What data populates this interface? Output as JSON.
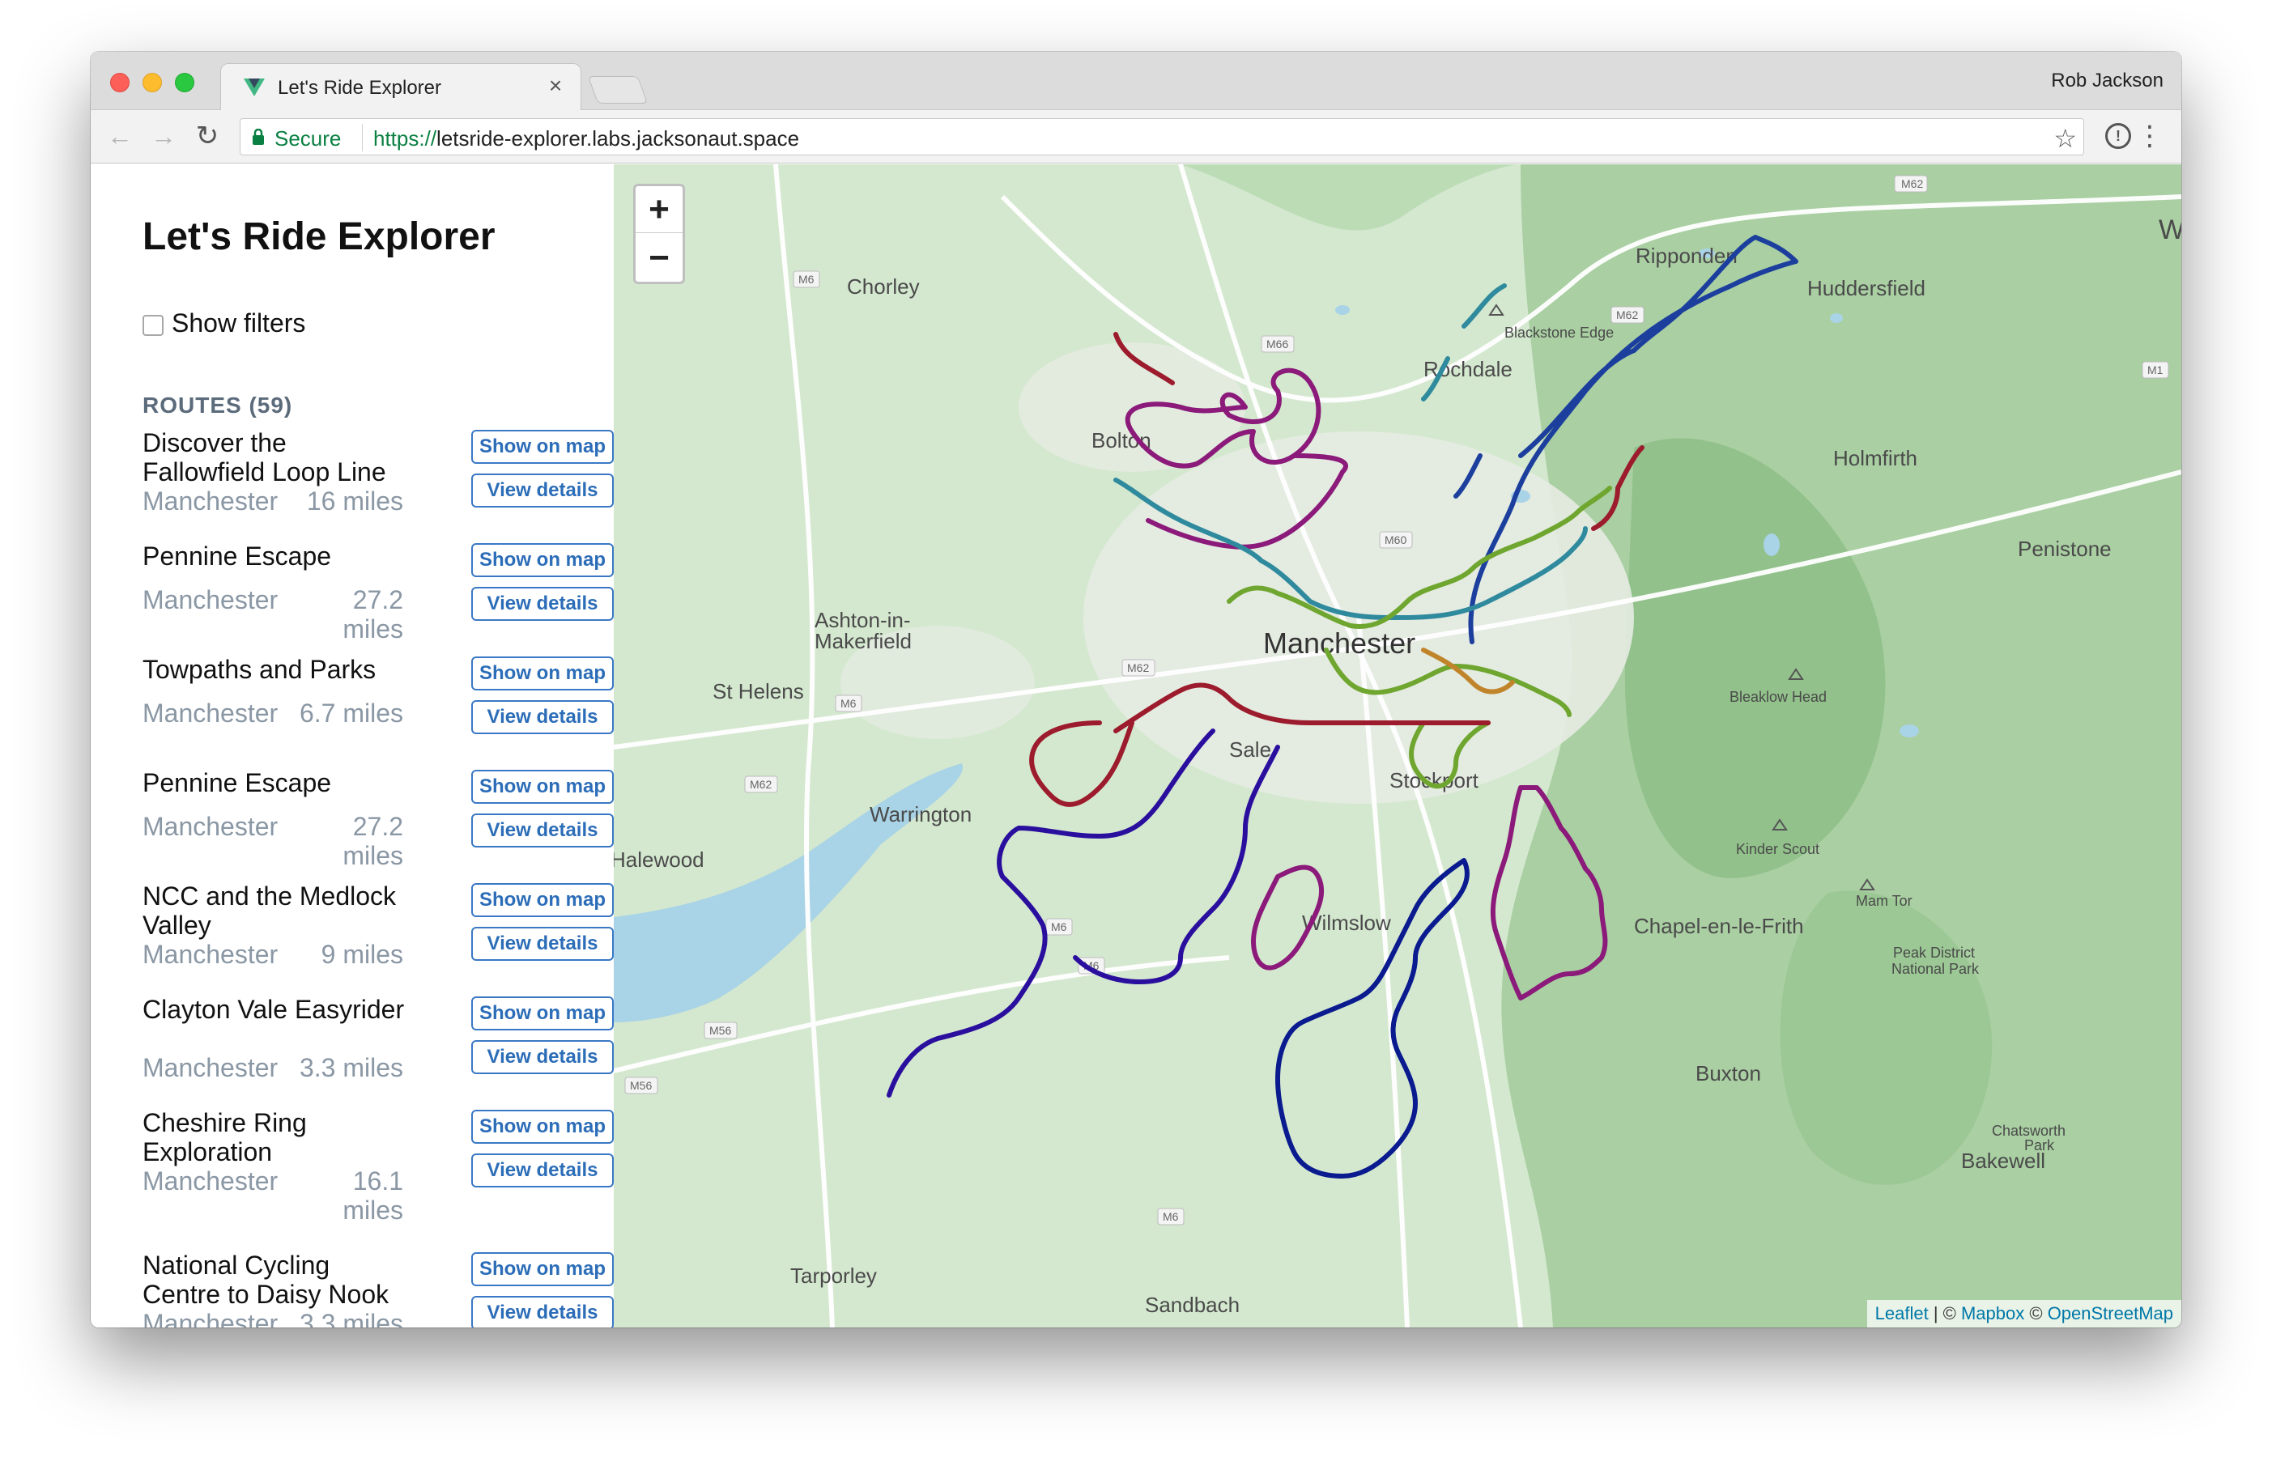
{
  "browser": {
    "tab_title": "Let's Ride Explorer",
    "tab_close": "×",
    "profile_name": "Rob Jackson",
    "secure_label": "Secure",
    "url_scheme": "https://",
    "url_rest": "letsride-explorer.labs.jacksonaut.space"
  },
  "sidebar": {
    "title": "Let's Ride Explorer",
    "show_filters_label": "Show filters",
    "routes_heading": "ROUTES (59)",
    "show_on_map_label": "Show on map",
    "view_details_label": "View details",
    "routes": [
      {
        "name": "Discover the Fallowfield Loop Line",
        "city": "Manchester",
        "miles": "16 miles"
      },
      {
        "name": "Pennine Escape",
        "city": "Manchester",
        "miles": "27.2 miles"
      },
      {
        "name": "Towpaths and Parks",
        "city": "Manchester",
        "miles": "6.7 miles"
      },
      {
        "name": "Pennine Escape",
        "city": "Manchester",
        "miles": "27.2 miles"
      },
      {
        "name": "NCC and the Medlock Valley",
        "city": "Manchester",
        "miles": "9 miles"
      },
      {
        "name": "Clayton Vale Easyrider",
        "city": "Manchester",
        "miles": "3.3 miles"
      },
      {
        "name": "Cheshire Ring Exploration",
        "city": "Manchester",
        "miles": "16.1 miles"
      },
      {
        "name": "National Cycling Centre to Daisy Nook",
        "city": "Manchester",
        "miles": "3.3 miles"
      }
    ]
  },
  "map": {
    "zoom_in": "+",
    "zoom_out": "−",
    "attribution": {
      "leaflet": "Leaflet",
      "sep1": " | © ",
      "mapbox": "Mapbox",
      "sep2": " © ",
      "osm": "OpenStreetMap"
    },
    "places": [
      {
        "name": "Chorley"
      },
      {
        "name": "Ripponden"
      },
      {
        "name": "Huddersfield"
      },
      {
        "name": "Blackstone Edge"
      },
      {
        "name": "Rochdale"
      },
      {
        "name": "Bolton"
      },
      {
        "name": "Holmfirth"
      },
      {
        "name": "Penistone"
      },
      {
        "name": "Ashton-in-"
      },
      {
        "name": "Makerfield"
      },
      {
        "name": "Manchester"
      },
      {
        "name": "St Helens"
      },
      {
        "name": "Bleaklow Head"
      },
      {
        "name": "Sale"
      },
      {
        "name": "Stockport"
      },
      {
        "name": "Warrington"
      },
      {
        "name": "Halewood"
      },
      {
        "name": "Kinder Scout"
      },
      {
        "name": "Mam Tor"
      },
      {
        "name": "Wilmslow"
      },
      {
        "name": "Chapel-en-le-Frith"
      },
      {
        "name": "Peak District"
      },
      {
        "name": "National Park"
      },
      {
        "name": "Buxton"
      },
      {
        "name": "Chatsworth"
      },
      {
        "name": "Park"
      },
      {
        "name": "Bakewell"
      },
      {
        "name": "Tarporley"
      },
      {
        "name": "Sandbach"
      },
      {
        "name": "Wa"
      }
    ],
    "road_shields": [
      "M62",
      "M6",
      "M66",
      "M62",
      "M1",
      "M60",
      "M62",
      "M6",
      "M62",
      "M6",
      "M56",
      "M6",
      "M56",
      "M6"
    ],
    "route_colors": [
      "#1c3f9e",
      "#8b1a7a",
      "#9c1b2c",
      "#6fa62f",
      "#2f8a9e",
      "#2a0f9e",
      "#c0852a",
      "#0a1a8f"
    ]
  }
}
